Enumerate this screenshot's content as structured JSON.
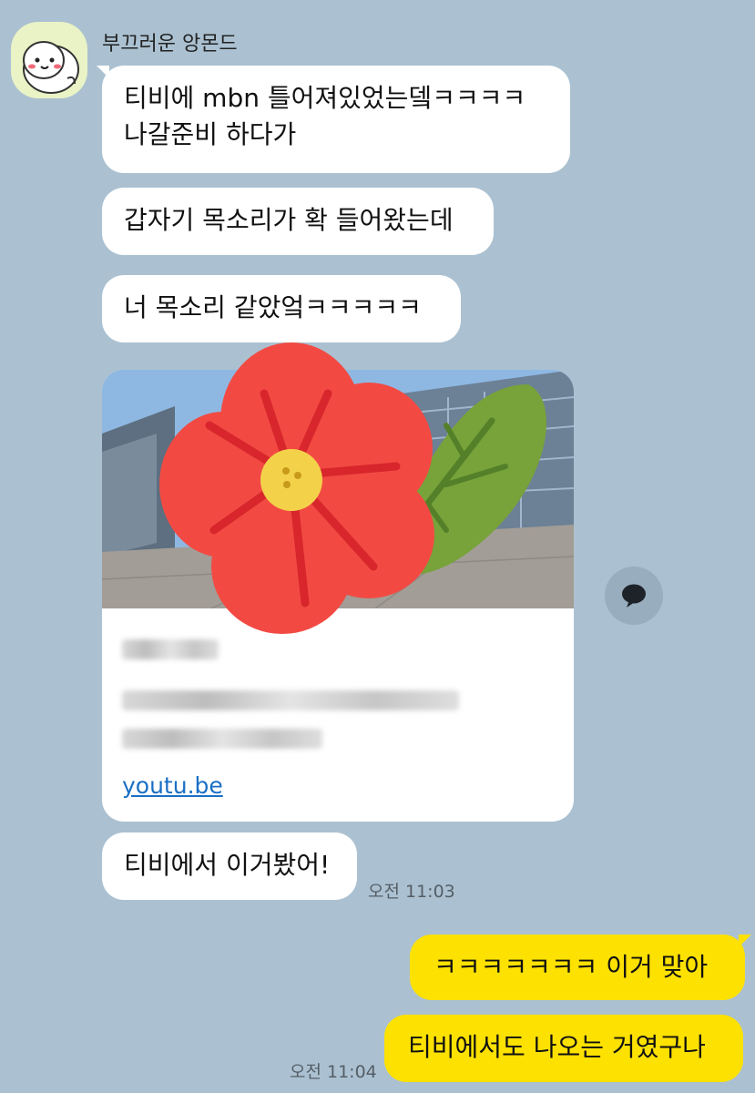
{
  "sender": {
    "name": "부끄러운 앙몬드",
    "avatar_icon": "smiling-face-avatar-icon"
  },
  "messages": {
    "m1_line1": "티비에 mbn 틀어져있었는뎈ㅋㅋㅋㅋ",
    "m1_line2": "나갈준비 하다가",
    "m2": "갑자기 목소리가 확 들어왔는데",
    "m3": "너 목소리 같았엌ㅋㅋㅋㅋㅋ",
    "m4": "티비에서 이거봤어!",
    "m4_time": "오전 11:03",
    "mine1": "ㅋㅋㅋㅋㅋㅋㅋ 이거 맞아",
    "mine2": "티비에서도 나오는 거였구나",
    "mine_time": "오전 11:04"
  },
  "link_card": {
    "url": "youtu.be",
    "thumbnail": "building-plaza-photo"
  },
  "share_button": {
    "icon": "speech-bubble-icon"
  },
  "sticker": {
    "icon": "red-flower-sticker-icon"
  },
  "colors": {
    "background": "#abc1d1",
    "my_bubble": "#fde100",
    "their_bubble": "#ffffff",
    "link": "#1a6fc4",
    "flower_red": "#f24a43",
    "leaf_green": "#77a33a"
  }
}
